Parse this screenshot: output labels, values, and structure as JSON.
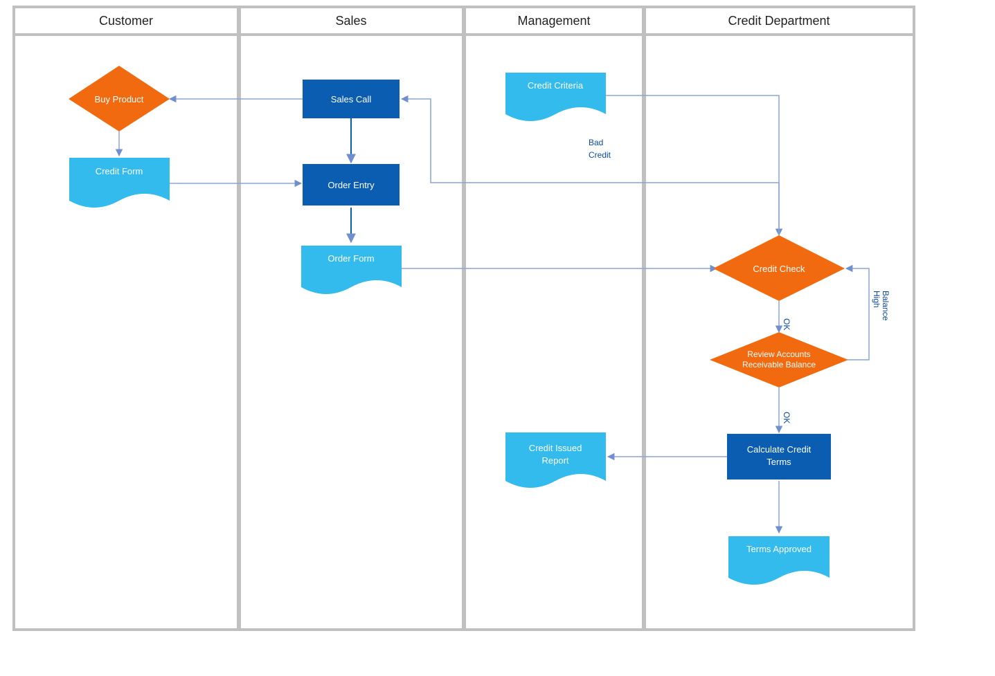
{
  "lanes": {
    "customer": "Customer",
    "sales": "Sales",
    "management": "Management",
    "credit": "Credit Department"
  },
  "nodes": {
    "buy_product": "Buy Product",
    "credit_form": "Credit Form",
    "sales_call": "Sales Call",
    "order_entry": "Order Entry",
    "order_form": "Order Form",
    "credit_criteria": "Credit Criteria",
    "credit_check": "Credit Check",
    "review_ar_l1": "Review Accounts",
    "review_ar_l2": "Receivable Balance",
    "calc_terms_l1": "Calculate Credit",
    "calc_terms_l2": "Terms",
    "credit_issued_l1": "Credit Issued",
    "credit_issued_l2": "Report",
    "terms_approved": "Terms Approved"
  },
  "edge_labels": {
    "bad_credit_l1": "Bad",
    "bad_credit_l2": "Credit",
    "ok1": "OK",
    "ok2": "OK",
    "high_l1": "High",
    "high_l2": "Balance"
  },
  "colors": {
    "lane_border": "#c0c0c0",
    "process": "#0b5db1",
    "decision": "#f26a0f",
    "document": "#33bbee",
    "connector": "#8aa4d6",
    "arrow": "#6f8fcf",
    "edge_text": "#0a4a9e"
  }
}
